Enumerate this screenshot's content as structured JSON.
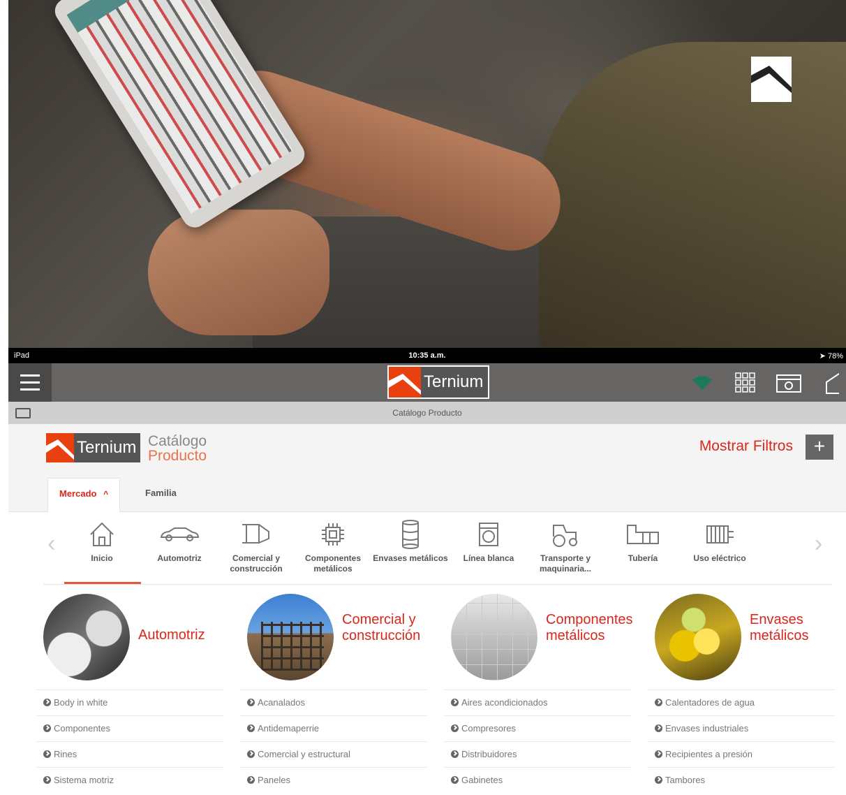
{
  "status_bar": {
    "device": "iPad",
    "time": "10:35 a.m.",
    "battery": "78%"
  },
  "navbar": {
    "brand": "Ternium",
    "icons": [
      "menu-icon",
      "wifi-icon",
      "grid-icon",
      "gallery-icon",
      "home-icon"
    ]
  },
  "subheader": {
    "title": "Catálogo Producto"
  },
  "catalog": {
    "brand": "Ternium",
    "title_line1": "Catálogo",
    "title_line2": "Producto",
    "show_filters": "Mostrar Filtros",
    "plus": "+"
  },
  "tabs": [
    {
      "label": "Mercado",
      "active": true
    },
    {
      "label": "Familia",
      "active": false
    }
  ],
  "markets": [
    {
      "label": "Inicio",
      "icon": "house-icon"
    },
    {
      "label": "Automotriz",
      "icon": "car-icon"
    },
    {
      "label": "Comercial y construcción",
      "icon": "beam-icon"
    },
    {
      "label": "Componentes metálicos",
      "icon": "chip-icon"
    },
    {
      "label": "Envases metálicos",
      "icon": "barrel-icon"
    },
    {
      "label": "Línea blanca",
      "icon": "washer-icon"
    },
    {
      "label": "Transporte y maquinaria...",
      "icon": "tractor-icon"
    },
    {
      "label": "Tubería",
      "icon": "pipe-icon"
    },
    {
      "label": "Uso eléctrico",
      "icon": "transformer-icon"
    }
  ],
  "categories": [
    {
      "title": "Automotriz",
      "items": [
        "Body in white",
        "Componentes",
        "Rines",
        "Sistema motriz"
      ]
    },
    {
      "title": "Comercial y construcción",
      "items": [
        "Acanalados",
        "Antidemaperrie",
        "Comercial y estructural",
        "Paneles"
      ]
    },
    {
      "title": "Componentes metálicos",
      "items": [
        "Aires acondicionados",
        "Compresores",
        "Distribuidores",
        "Gabinetes"
      ]
    },
    {
      "title": "Envases metálicos",
      "items": [
        "Calentadores de agua",
        "Envases industriales",
        "Recipientes a presión",
        "Tambores"
      ]
    }
  ],
  "colors": {
    "accent": "#d9271c",
    "brand_orange": "#e8400f",
    "navbar": "#666563"
  }
}
